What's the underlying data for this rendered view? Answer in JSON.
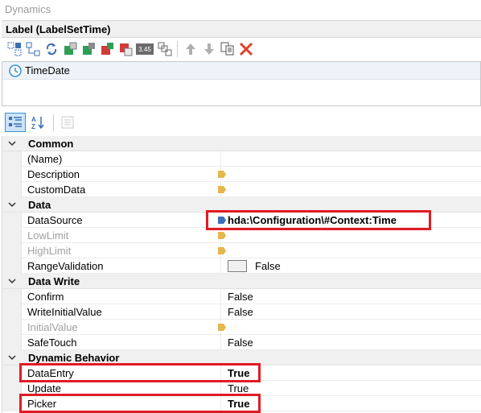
{
  "panel": {
    "title": "Dynamics"
  },
  "object": {
    "header": "Label (LabelSetTime)"
  },
  "toolbar": {
    "icons": [
      "select-all-icon",
      "connect-icon",
      "refresh-icon",
      "add-green-icon",
      "remove-green-icon",
      "add-red-icon",
      "remove-red-icon",
      "number-icon",
      "group-icon",
      "move-up-icon",
      "move-down-icon",
      "copy-icon",
      "delete-icon"
    ],
    "number_label": "3.45"
  },
  "dynamics_list": {
    "items": [
      {
        "label": "TimeDate",
        "icon": "clock-icon"
      }
    ]
  },
  "property_toolbar": {
    "icons": [
      "categorized-icon",
      "alphabetical-icon",
      "property-pages-icon"
    ]
  },
  "properties": {
    "common": {
      "title": "Common",
      "name": {
        "name": "(Name)",
        "value": ""
      },
      "description": {
        "name": "Description",
        "value": ""
      },
      "customdata": {
        "name": "CustomData",
        "value": ""
      }
    },
    "data": {
      "title": "Data",
      "datasource": {
        "name": "DataSource",
        "value": "hda:\\Configuration\\#Context:Time"
      },
      "lowlimit": {
        "name": "LowLimit",
        "value": ""
      },
      "highlimit": {
        "name": "HighLimit",
        "value": ""
      },
      "rangevalidation": {
        "name": "RangeValidation",
        "value": "False"
      }
    },
    "datawrite": {
      "title": "Data Write",
      "confirm": {
        "name": "Confirm",
        "value": "False"
      },
      "writeinitialvalue": {
        "name": "WriteInitialValue",
        "value": "False"
      },
      "initialvalue": {
        "name": "InitialValue",
        "value": ""
      },
      "safetouch": {
        "name": "SafeTouch",
        "value": "False"
      }
    },
    "dynamic": {
      "title": "Dynamic Behavior",
      "dataentry": {
        "name": "DataEntry",
        "value": "True"
      },
      "update": {
        "name": "Update",
        "value": "True"
      },
      "picker": {
        "name": "Picker",
        "value": "True"
      }
    }
  },
  "colors": {
    "highlight": "#e01b24",
    "tag": "#e6b64c",
    "accent": "#3c8fd4"
  }
}
